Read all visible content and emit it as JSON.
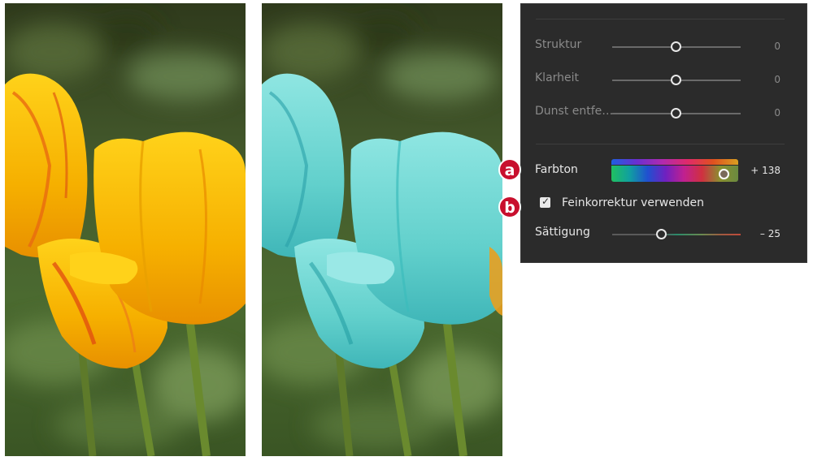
{
  "panel": {
    "sliders": [
      {
        "label": "Struktur",
        "value": "0"
      },
      {
        "label": "Klarheit",
        "value": "0"
      },
      {
        "label": "Dunst entfe…",
        "value": "0"
      }
    ],
    "hue": {
      "label": "Farbton",
      "value": "+ 138",
      "position": 0.9
    },
    "fine_tune": {
      "label": "Feinkorrektur verwenden",
      "checked": true
    },
    "saturation": {
      "label": "Sättigung",
      "value": "– 25",
      "position": 0.4
    }
  },
  "annotations": {
    "a": "a",
    "b": "b"
  },
  "colors": {
    "panel_bg": "#2b2b2b",
    "badge": "#c8102e",
    "tulip_original": "#f4b400",
    "tulip_recolored": "#6fd6d3"
  }
}
